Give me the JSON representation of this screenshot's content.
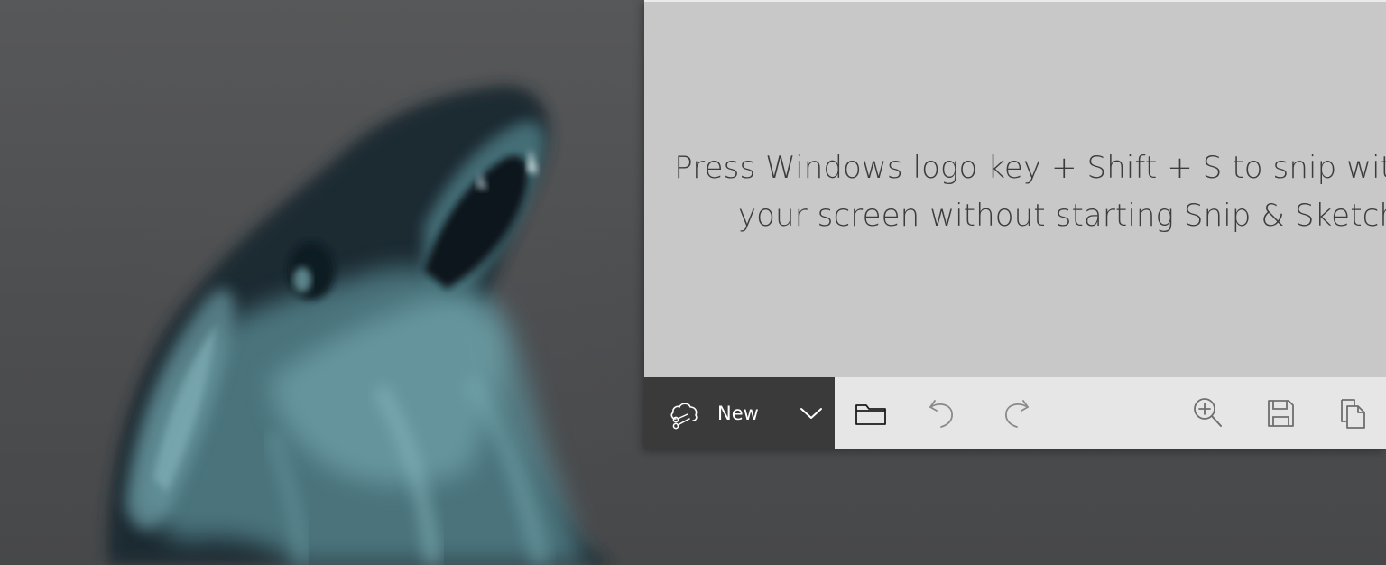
{
  "desktop": {
    "wallpaper": "dark-wolf-painting"
  },
  "app": {
    "hint_line1": "Press Windows logo key + Shift + S to snip without",
    "hint_line2": "your screen without starting Snip & Sketch",
    "toolbar": {
      "new_label": "New",
      "new_icon": "snip-scissors-icon",
      "dropdown_icon": "chevron-down-icon",
      "open_icon": "folder-icon",
      "undo_icon": "undo-icon",
      "redo_icon": "redo-icon",
      "zoom_icon": "zoom-in-icon",
      "save_icon": "save-icon",
      "copy_icon": "copy-icon"
    },
    "colors": {
      "canvas": "#c8c8c8",
      "toolbar": "#e6e6e6",
      "new_button": "#3a3a3a"
    }
  }
}
